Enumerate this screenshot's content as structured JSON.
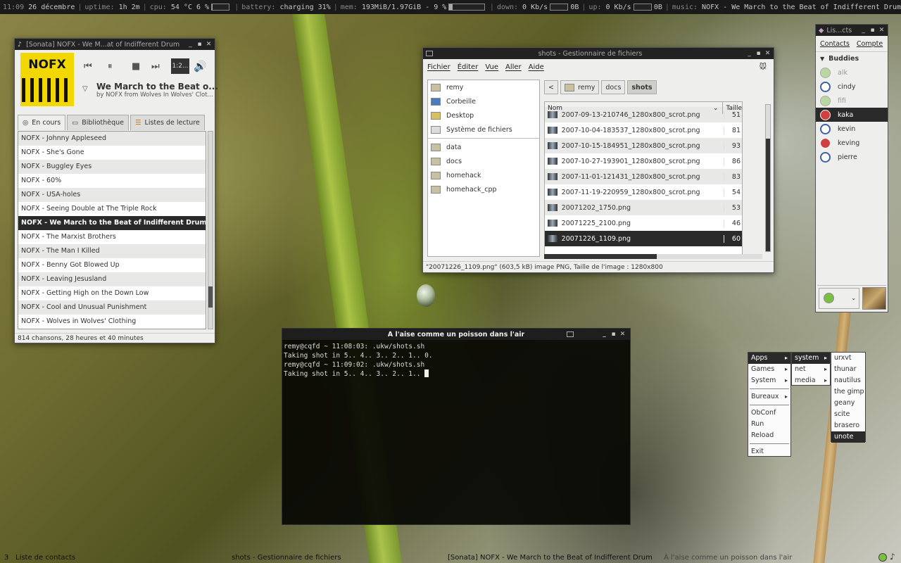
{
  "topbar": {
    "time": "11:09",
    "date": "26 décembre",
    "uptime_label": "uptime:",
    "uptime": "1h 2m",
    "cpu_label": "cpu:",
    "cpu": "54  °C 6  %",
    "cpu_level": 0.06,
    "battery_label": "battery:",
    "battery": "charging 31%",
    "mem_label": "mem:",
    "mem": "193MiB/1.97GiB - 9  %",
    "mem_level": 0.09,
    "down_label": "down:",
    "down": "0    Kb/s",
    "down_total": "0B",
    "up_label": "up:",
    "up": "0    Kb/s",
    "up_total": "0B",
    "music_label": "music:",
    "music": "NOFX - We March to the Beat of Indifferent Drum"
  },
  "sonata": {
    "title": "[Sonata] NOFX - We M...at of Indifferent Drum",
    "art_text": "NOFX",
    "time_text": "1:2...",
    "song_title": "We March to the Beat o...",
    "song_sub": "by NOFX from Wolves In Wolves' Clot...",
    "tabs": [
      "En cours",
      "Bibliothèque",
      "Listes de lecture"
    ],
    "playlist": [
      "NOFX - Johnny Appleseed",
      "NOFX - She's Gone",
      "NOFX - Buggley Eyes",
      "NOFX - 60%",
      "NOFX - USA-holes",
      "NOFX - Seeing Double at The Triple Rock",
      "NOFX - We March to the Beat of Indifferent Drum",
      "NOFX - The Marxist Brothers",
      "NOFX - The Man I Killed",
      "NOFX - Benny Got Blowed Up",
      "NOFX - Leaving Jesusland",
      "NOFX - Getting High on the Down Low",
      "NOFX - Cool and Unusual Punishment",
      "NOFX - Wolves in Wolves' Clothing"
    ],
    "selected_index": 6,
    "status": "814 chansons, 28 heures et 40 minutes"
  },
  "filemanager": {
    "title": "shots - Gestionnaire de fichiers",
    "menu": [
      "Fichier",
      "Éditer",
      "Vue",
      "Aller",
      "Aide"
    ],
    "places": [
      "remy",
      "Corbeille",
      "Desktop",
      "Système de fichiers"
    ],
    "bookmarks": [
      "data",
      "docs",
      "homehack",
      "homehack_cpp"
    ],
    "path": [
      "remy",
      "docs",
      "shots"
    ],
    "col_name": "Nom",
    "col_size": "Taille",
    "files": [
      {
        "name": "2007-09-13-210746_1280x800_scrot.png",
        "size": "51"
      },
      {
        "name": "2007-10-04-183537_1280x800_scrot.png",
        "size": "81"
      },
      {
        "name": "2007-10-15-184951_1280x800_scrot.png",
        "size": "93"
      },
      {
        "name": "2007-10-27-193901_1280x800_scrot.png",
        "size": "86"
      },
      {
        "name": "2007-11-01-121431_1280x800_scrot.png",
        "size": "83"
      },
      {
        "name": "2007-11-19-220959_1280x800_scrot.png",
        "size": "54"
      },
      {
        "name": "20071202_1750.png",
        "size": "53"
      },
      {
        "name": "20071225_2100.png",
        "size": "46"
      },
      {
        "name": "20071226_1109.png",
        "size": "60"
      }
    ],
    "status": "\"20071226_1109.png\" (603,5 kB) image PNG, Taille de l'image : 1280x800"
  },
  "terminal": {
    "title": "À l'aise comme un poisson dans l'air",
    "lines": [
      "remy@cqfd ~ 11:08:03: .ukw/shots.sh",
      "Taking shot in 5.. 4.. 3.. 2.. 1.. 0.",
      "remy@cqfd ~ 11:09:02: .ukw/shots.sh",
      "Taking shot in 5.. 4.. 3.. 2.. 1.. "
    ]
  },
  "contacts": {
    "title": "Lis...cts",
    "menu": [
      "Contacts",
      "Compte"
    ],
    "group": "Buddies",
    "buddies": [
      {
        "name": "alk",
        "status": "offline"
      },
      {
        "name": "cindy",
        "status": "away"
      },
      {
        "name": "fifi",
        "status": "offline"
      },
      {
        "name": "kaka",
        "status": "busy"
      },
      {
        "name": "kevin",
        "status": "away"
      },
      {
        "name": "keving",
        "status": "busy"
      },
      {
        "name": "pierre",
        "status": "away"
      }
    ],
    "selected": "kaka"
  },
  "menu": {
    "root": [
      "Apps",
      "Games",
      "System",
      "Bureaux",
      "ObConf",
      "Run",
      "Reload",
      "Exit"
    ],
    "apps": [
      "system",
      "net",
      "media"
    ],
    "system": [
      "urxvt",
      "thunar",
      "nautilus",
      "the gimp",
      "geany",
      "scite",
      "brasero",
      "unote"
    ]
  },
  "taskbar": {
    "desktop": "3",
    "tasks": [
      "Liste de contacts",
      "shots - Gestionnaire de fichiers",
      "[Sonata] NOFX - We March to the Beat of Indifferent Drum",
      "À l'aise comme un poisson dans l'air"
    ]
  }
}
